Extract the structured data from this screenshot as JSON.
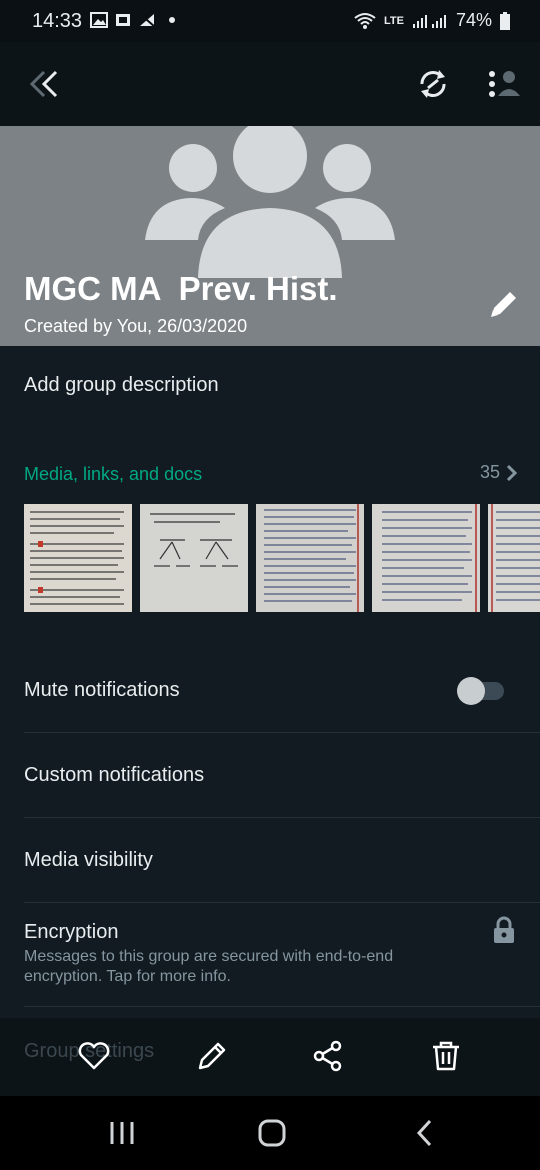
{
  "status_bar": {
    "time": "14:33",
    "network": "LTE",
    "battery": "74%"
  },
  "header": {
    "group_name": "MGC MA  Prev. Hist.",
    "created": "Created by You, 26/03/2020"
  },
  "description": {
    "placeholder": "Add group description"
  },
  "media": {
    "title": "Media, links, and docs",
    "count": "35"
  },
  "settings": {
    "mute": "Mute notifications",
    "mute_enabled": false,
    "custom": "Custom notifications",
    "visibility": "Media visibility",
    "encryption_title": "Encryption",
    "encryption_sub": "Messages to this group are secured with end-to-end encryption. Tap for more info.",
    "group_settings": "Group settings"
  },
  "colors": {
    "accent": "#00a884",
    "background": "#111b21",
    "header_bg": "#7d8286"
  },
  "icons": [
    "back-icon",
    "sync-icon",
    "more-people-icon",
    "edit-icon",
    "chevron-right-icon",
    "lock-icon",
    "heart-icon",
    "pencil-icon",
    "share-icon",
    "trash-icon",
    "recents-icon",
    "home-icon",
    "nav-back-icon"
  ]
}
